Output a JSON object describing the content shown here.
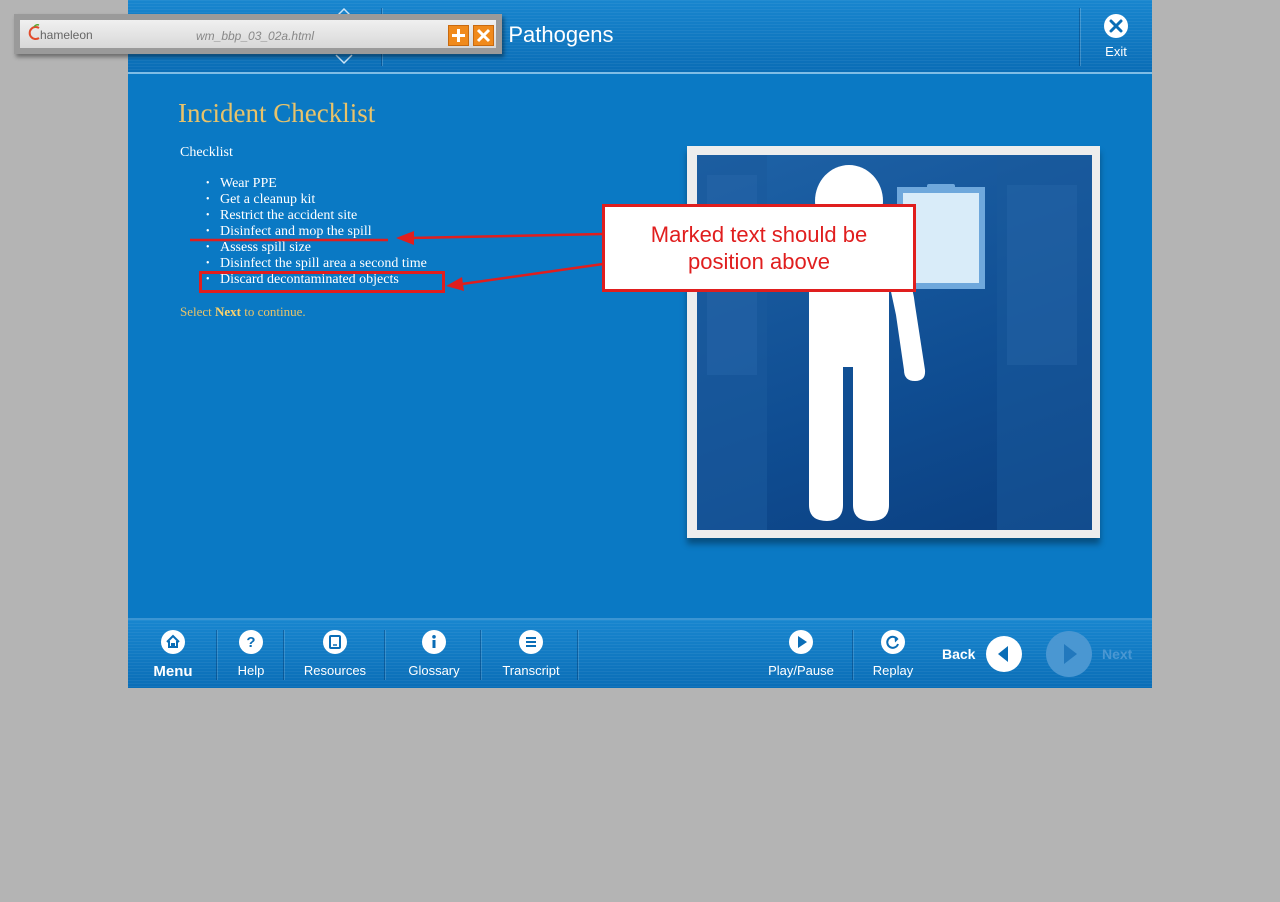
{
  "header": {
    "course_title": "e Pathogens",
    "exit_label": "Exit"
  },
  "content": {
    "heading": "Incident Checklist",
    "checklist_label": "Checklist",
    "items": [
      "Wear PPE",
      "Get a cleanup kit",
      "Restrict the accident site",
      "Disinfect and mop the spill",
      "Assess spill size",
      "Disinfect the spill area a second time",
      "Discard decontaminated objects"
    ],
    "continue_prefix": "Select",
    "continue_next": "Next",
    "continue_suffix": "to continue."
  },
  "footer": {
    "menu": "Menu",
    "help": "Help",
    "resources": "Resources",
    "glossary": "Glossary",
    "transcript": "Transcript",
    "play_pause": "Play/Pause",
    "replay": "Replay",
    "back": "Back",
    "next": "Next"
  },
  "chameleon": {
    "logo": "hameleon",
    "filename": "wm_bbp_03_02a.html"
  },
  "annotation": {
    "text_line1": "Marked text should be",
    "text_line2": "position above"
  },
  "colors": {
    "stage_blue": "#0a79c4",
    "heading_gold": "#e8c36a",
    "annotation_red": "#e01e1e",
    "next_disabled": "#4a97d2"
  }
}
